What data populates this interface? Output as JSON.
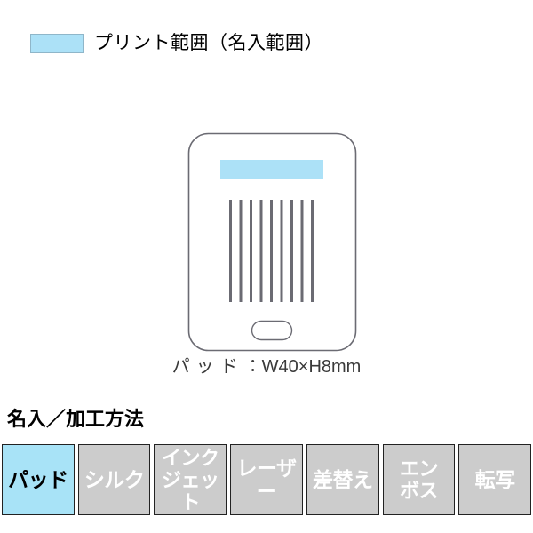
{
  "legend": {
    "swatch_name": "print-area-swatch",
    "swatch_color": "#ace1f7",
    "swatch_border_color": "#8fb6c9",
    "label": "プリント範囲（名入範囲）"
  },
  "product": {
    "alt_name": "tablet-device-outline",
    "outline_color": "#6b6b73",
    "print_area_color": "#ace1f7",
    "bar_color": "#6b6b73",
    "bar_count": 9,
    "home_button_name": "home-button"
  },
  "size_caption": {
    "method": "パッド",
    "separator": "：",
    "dimensions": "W40×H8mm"
  },
  "method_section": {
    "heading": "名入／加工方法",
    "active_color": "#a8e3f7",
    "inactive_color": "#cccccc",
    "chips": [
      {
        "label": "パッド",
        "active": true,
        "lines": 1
      },
      {
        "label": "シルク",
        "active": false,
        "lines": 1
      },
      {
        "label": "インク\nジェット",
        "active": false,
        "lines": 2
      },
      {
        "label": "レーザー",
        "active": false,
        "lines": 1
      },
      {
        "label": "差替え",
        "active": false,
        "lines": 1
      },
      {
        "label": "エン\nボス",
        "active": false,
        "lines": 2
      },
      {
        "label": "転写",
        "active": false,
        "lines": 1
      }
    ]
  }
}
